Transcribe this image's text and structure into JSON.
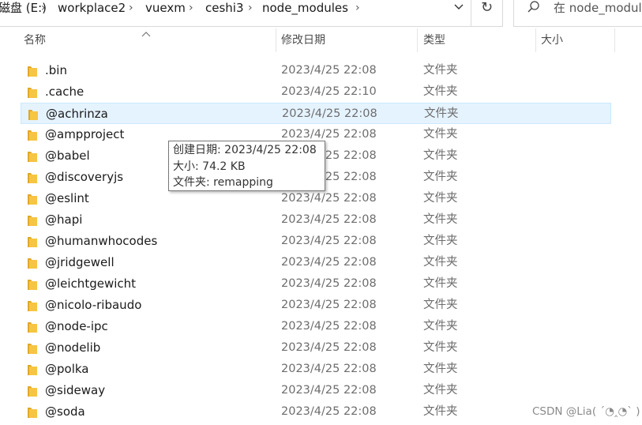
{
  "address_bar": {
    "crumbs": [
      "磁盘 (E:)",
      "workplace2",
      "vuexm",
      "ceshi3",
      "node_modules"
    ],
    "separator": "›",
    "dropdown_icon": "chevron-down-icon"
  },
  "refresh": {
    "icon": "refresh-icon",
    "glyph": "↻"
  },
  "search": {
    "text": "在 node_modul",
    "icon": "search-icon"
  },
  "columns": {
    "name": "名称",
    "date": "修改日期",
    "type": "类型",
    "size": "大小"
  },
  "rows": [
    {
      "name": ".bin",
      "date": "2023/4/25 22:08",
      "type": "文件夹"
    },
    {
      "name": ".cache",
      "date": "2023/4/25 22:10",
      "type": "文件夹"
    },
    {
      "name": "@achrinza",
      "date": "2023/4/25 22:08",
      "type": "文件夹",
      "selected": true
    },
    {
      "name": "@ampproject",
      "date": "2023/4/25 22:08",
      "type": "文件夹"
    },
    {
      "name": "@babel",
      "date": "2023/4/25 22:08",
      "type": "文件夹"
    },
    {
      "name": "@discoveryjs",
      "date": "2023/4/25 22:08",
      "type": "文件夹"
    },
    {
      "name": "@eslint",
      "date": "2023/4/25 22:08",
      "type": "文件夹"
    },
    {
      "name": "@hapi",
      "date": "2023/4/25 22:08",
      "type": "文件夹"
    },
    {
      "name": "@humanwhocodes",
      "date": "2023/4/25 22:08",
      "type": "文件夹"
    },
    {
      "name": "@jridgewell",
      "date": "2023/4/25 22:08",
      "type": "文件夹"
    },
    {
      "name": "@leichtgewicht",
      "date": "2023/4/25 22:08",
      "type": "文件夹"
    },
    {
      "name": "@nicolo-ribaudo",
      "date": "2023/4/25 22:08",
      "type": "文件夹"
    },
    {
      "name": "@node-ipc",
      "date": "2023/4/25 22:08",
      "type": "文件夹"
    },
    {
      "name": "@nodelib",
      "date": "2023/4/25 22:08",
      "type": "文件夹"
    },
    {
      "name": "@polka",
      "date": "2023/4/25 22:08",
      "type": "文件夹"
    },
    {
      "name": "@sideway",
      "date": "2023/4/25 22:08",
      "type": "文件夹"
    },
    {
      "name": "@soda",
      "date": "2023/4/25 22:08",
      "type": "文件夹"
    }
  ],
  "tooltip": {
    "created": "创建日期: 2023/4/25 22:08",
    "size": "大小: 74.2 KB",
    "folders": "文件夹: remapping"
  },
  "watermark": "CSDN @Lia( ´◔‸◔` )",
  "colors": {
    "folder": "#f6c543",
    "folder_dark": "#e0a82a",
    "selected_bg": "#e5f3ff",
    "selected_border": "#cce8ff"
  }
}
